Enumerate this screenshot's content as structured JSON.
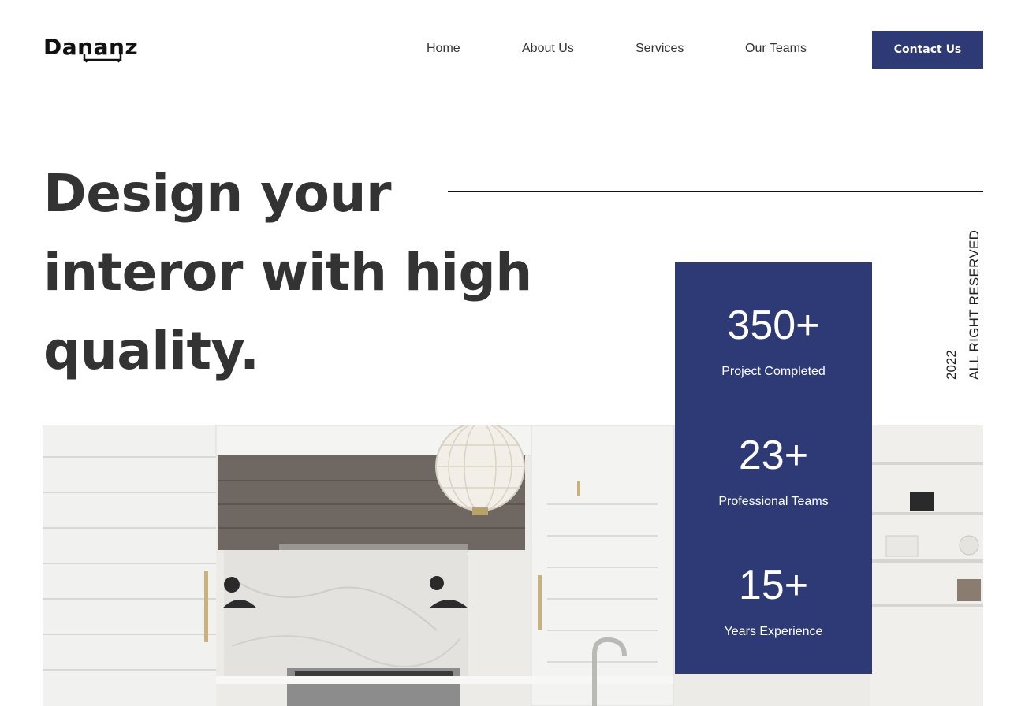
{
  "brand": {
    "name": "Dananz"
  },
  "nav": {
    "items": [
      {
        "label": "Home"
      },
      {
        "label": "About Us"
      },
      {
        "label": "Services"
      },
      {
        "label": "Our Teams"
      }
    ],
    "cta_label": "Contact Us"
  },
  "hero": {
    "headline_lines": [
      "Design your",
      "interor with high",
      "quality."
    ],
    "side_year": "2022",
    "side_rights": "ALL RIGHT RESERVED",
    "image_icon": "kitchen-interior-photo"
  },
  "stats": [
    {
      "number": "350+",
      "label": "Project Completed"
    },
    {
      "number": "23+",
      "label": "Professional Teams"
    },
    {
      "number": "15+",
      "label": "Years Experience"
    }
  ],
  "colors": {
    "accent": "#2d3a75",
    "text": "#333333",
    "background": "#ffffff"
  }
}
